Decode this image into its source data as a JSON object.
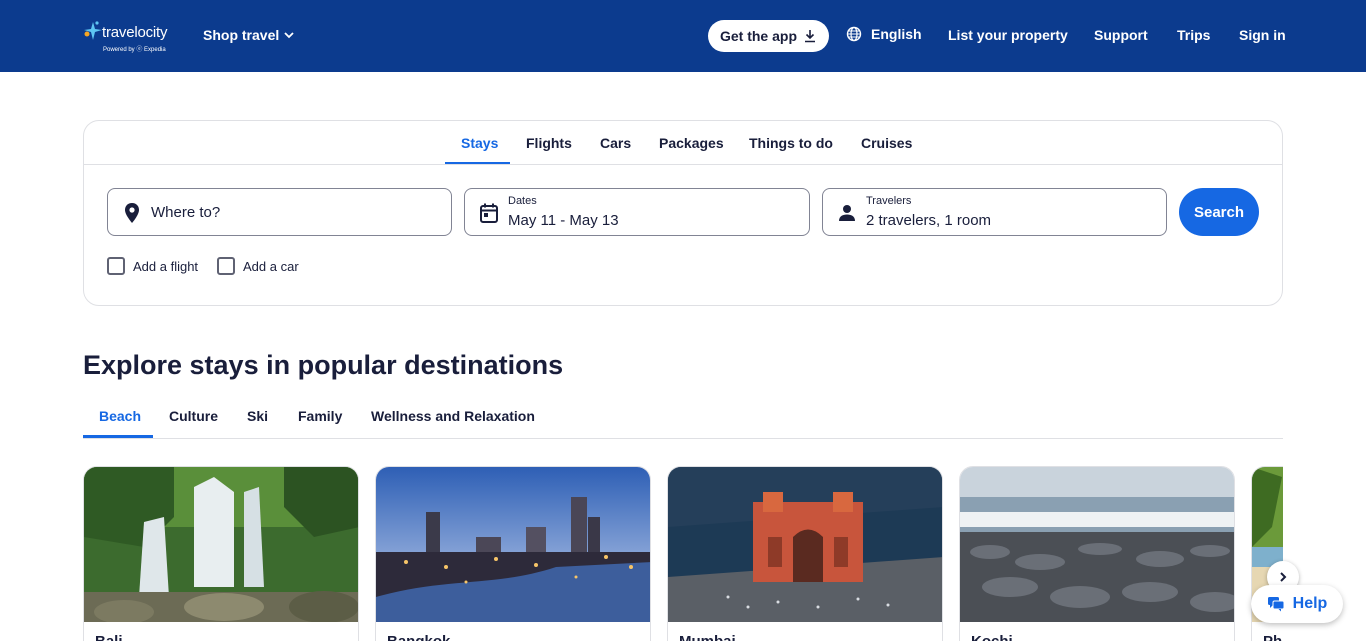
{
  "header": {
    "logo_name": "travelocity",
    "logo_sub": "Powered by ⓔ Expedia",
    "shop_travel": "Shop travel",
    "get_app": "Get the app",
    "language": "English",
    "list_property": "List your property",
    "support": "Support",
    "trips": "Trips",
    "sign_in": "Sign in"
  },
  "search": {
    "tabs": [
      "Stays",
      "Flights",
      "Cars",
      "Packages",
      "Things to do",
      "Cruises"
    ],
    "active_tab": "Stays",
    "where_placeholder": "Where to?",
    "dates_label": "Dates",
    "dates_value": "May 11 - May 13",
    "travelers_label": "Travelers",
    "travelers_value": "2 travelers, 1 room",
    "search_button": "Search",
    "add_flight": "Add a flight",
    "add_car": "Add a car"
  },
  "explore": {
    "title": "Explore stays in popular destinations",
    "tabs": [
      "Beach",
      "Culture",
      "Ski",
      "Family",
      "Wellness and Relaxation"
    ],
    "active_tab": "Beach",
    "cards": [
      {
        "name": "Bali"
      },
      {
        "name": "Bangkok"
      },
      {
        "name": "Mumbai"
      },
      {
        "name": "Kochi"
      },
      {
        "name": "Phuket"
      }
    ]
  },
  "help": "Help",
  "colors": {
    "header_bg": "#0c3b8e",
    "accent": "#1668e3",
    "text": "#191e3b",
    "border": "#dfe0e4"
  }
}
